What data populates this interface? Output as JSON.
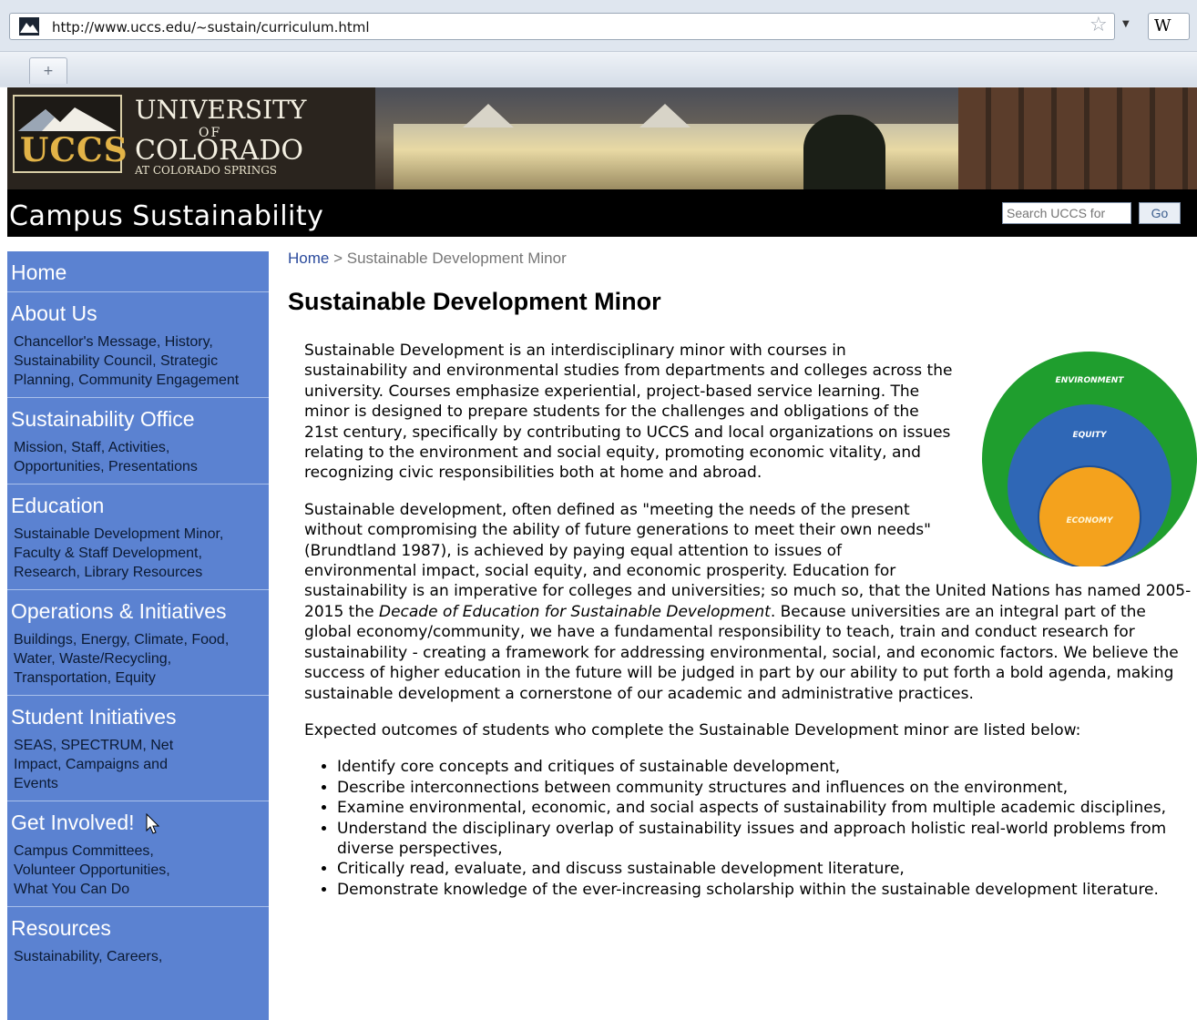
{
  "browser": {
    "url": "http://www.uccs.edu/~sustain/curriculum.html",
    "wiki_label": "W",
    "newtab_label": "+"
  },
  "header": {
    "logo_uccs": "UCCS",
    "logo_university": "UNIVERSITY",
    "logo_of": "OF",
    "logo_colorado": "COLORADO",
    "logo_springs": "AT COLORADO SPRINGS",
    "site_title": "Campus Sustainability",
    "search_placeholder": "Search UCCS for",
    "go_label": "Go"
  },
  "sidebar": [
    {
      "heading": "Home",
      "sub": ""
    },
    {
      "heading": "About Us",
      "sub": "Chancellor's Message, History, Sustainability Council, Strategic Planning, Community Engagement"
    },
    {
      "heading": "Sustainability Office",
      "sub": "Mission, Staff, Activities, Opportunities, Presentations"
    },
    {
      "heading": "Education",
      "sub": "Sustainable Development Minor, Faculty & Staff Development, Research, Library Resources"
    },
    {
      "heading": "Operations & Initiatives",
      "sub": "Buildings, Energy, Climate, Food, Water, Waste/Recycling, Transportation, Equity"
    },
    {
      "heading": "Student Initiatives",
      "sub": "SEAS, SPECTRUM, Net Impact, Campaigns and Events"
    },
    {
      "heading": "Get Involved!",
      "sub": "Campus Committees, Volunteer Opportunities, What You Can Do"
    },
    {
      "heading": "Resources",
      "sub": "Sustainability, Careers,"
    }
  ],
  "main": {
    "breadcrumb_home": "Home",
    "breadcrumb_sep": ">",
    "breadcrumb_current": "Sustainable Development Minor",
    "title": "Sustainable Development Minor",
    "para1": "Sustainable Development is an interdisciplinary minor with courses in sustainability and environmental studies from departments and colleges across the university. Courses emphasize experiential, project-based service learning. The minor is designed to prepare students for the challenges and obligations of the 21st century, specifically by contributing to UCCS and local organizations on issues relating to the environment and social equity, promoting economic vitality, and recognizing civic responsibilities both at home and abroad.",
    "para2_before": "Sustainable development, often defined as \"meeting the needs of the present without compromising the ability of future generations to meet their own needs\" (Brundtland 1987), is achieved by paying equal attention to issues of environmental impact, social equity, and economic prosperity. Education for sustainability is an imperative for colleges and universities; so much so, that the United Nations has named 2005-2015 the ",
    "para2_italic": "Decade of Education for Sustainable Development",
    "para2_after": ". Because universities are an integral part of the global economy/community, we have a fundamental responsibility to teach, train and conduct research for sustainability - creating a framework for addressing environmental, social, and economic factors. We believe the success of higher education in the future will be judged in part by our ability to put forth a bold agenda, making sustainable development a cornerstone of our academic and administrative practices.",
    "outcomes_intro": "Expected outcomes of students who complete the Sustainable Development minor are listed below:",
    "outcomes": [
      "Identify core concepts and critiques of sustainable development,",
      "Describe interconnections between community structures and influences on the environment,",
      "Examine environmental, economic, and social aspects of sustainability from multiple academic disciplines,",
      "Understand the disciplinary overlap of sustainability issues and approach holistic real-world problems from diverse perspectives,",
      "Critically read, evaluate, and discuss sustainable development literature,",
      "Demonstrate knowledge of the ever-increasing scholarship within the sustainable development literature."
    ],
    "diagram": {
      "outer_label": "ENVIRONMENT",
      "middle_label": "EQUITY",
      "inner_label": "ECONOMY",
      "outer_color": "#1f9e2e",
      "middle_color": "#2f67b6",
      "inner_color": "#f4a21d"
    }
  }
}
